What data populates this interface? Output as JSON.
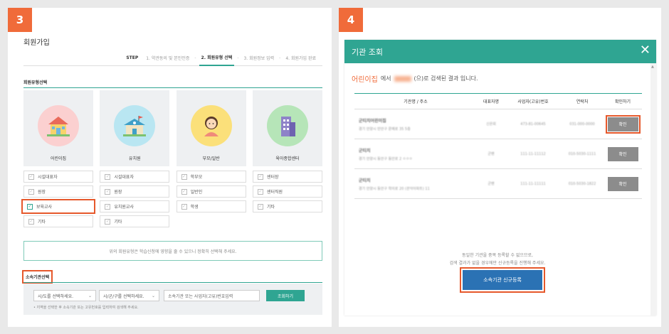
{
  "panel3": {
    "badge": "3",
    "title": "회원가입",
    "steps": {
      "label": "STEP",
      "items": [
        "1. 약관동의 및 본인인증",
        "2. 회원유형 선택",
        "3. 회원정보 입력",
        "4. 회원가입 완료"
      ]
    },
    "member_type_title": "회원유형선택",
    "cards": [
      {
        "label": "어린이집",
        "icon": "house-icon"
      },
      {
        "label": "유치원",
        "icon": "kindergarten-icon"
      },
      {
        "label": "부모/일반",
        "icon": "person-icon"
      },
      {
        "label": "육아종합센터",
        "icon": "building-icon"
      }
    ],
    "checks": [
      [
        "시설대표자",
        "원장",
        "보육교사",
        "기타"
      ],
      [
        "시설대표자",
        "원장",
        "유치원교사",
        "기타"
      ],
      [
        "학부모",
        "일반인",
        "학생"
      ],
      [
        "센터장",
        "센터직원",
        "기타"
      ]
    ],
    "notice": "위의 회원유형은 학습신청에 영향을 줄 수 있으니 정확히 선택해 주세요.",
    "agency_title": "소속기관선택",
    "search": {
      "select1": "시/도를 선택하세요.",
      "select2": "시/군/구를 선택하세요.",
      "placeholder": "소속기관 또는 사업자(고유)번호입력",
      "button": "조회하기",
      "help": "• 지역을 선택한 후 소속기관 또는 고유번호를 입력하여 검색해 주세요."
    }
  },
  "panel4": {
    "badge": "4",
    "modal_title": "기관 조회",
    "result": {
      "keyword": "어린이집",
      "mid": "에서",
      "suffix": "(으)로 검색된 결과 입니다."
    },
    "columns": [
      "기관명 / 주소",
      "대표자명",
      "사업자(고유)번호",
      "연락처",
      "확인하기"
    ],
    "rows": [
      {
        "name": "군티치어린이집",
        "addr": "경기 안양시 만안구 문예로 35 5층",
        "rep": "신은희",
        "biz": "473-81-00645",
        "tel": "031-000-0000",
        "btn": "확인"
      },
      {
        "name": "군티치",
        "addr": "경기 안양시 동안구 동안로 2 ㅇㅇㅇ",
        "rep": "군밴",
        "biz": "111-11-11112",
        "tel": "010-5030-1111",
        "btn": "확인"
      },
      {
        "name": "군티치",
        "addr": "경기 안양시 동안구 학의로 20 (관악아파트) 11",
        "rep": "군밴",
        "biz": "111-11-11111",
        "tel": "010-5030-1822",
        "btn": "확인"
      }
    ],
    "dup_line1": "동일한 기관을 중복 등록할 수 없으므로,",
    "dup_line2": "검색 결과가 없을 경우에만 신규등록을 진행해 주세요.",
    "register_button": "소속기관 신규등록"
  },
  "colors": {
    "accent": "#2fa592",
    "highlight": "#e6582b",
    "badge": "#f06b3a",
    "primary_button": "#2b72b4"
  }
}
